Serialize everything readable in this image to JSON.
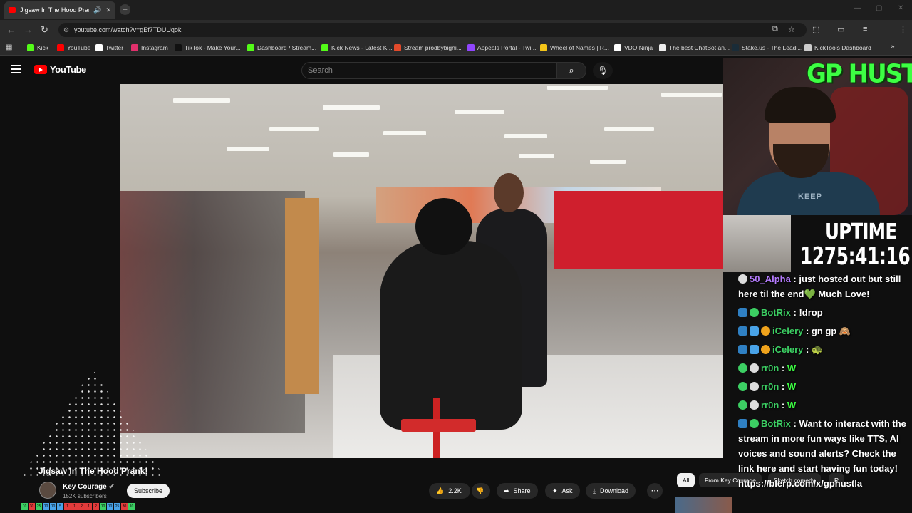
{
  "browser": {
    "tab_title": "Jigsaw In The Hood Prank!",
    "url": "youtube.com/watch?v=gEf7TDUUqok",
    "bookmarks": [
      {
        "label": "Kick",
        "color": "#53fc18"
      },
      {
        "label": "YouTube",
        "color": "#ff0000"
      },
      {
        "label": "Twitter",
        "color": "#ffffff"
      },
      {
        "label": "Instagram",
        "color": "#e1306c"
      },
      {
        "label": "TikTok - Make Your...",
        "color": "#111111"
      },
      {
        "label": "Dashboard / Stream...",
        "color": "#53fc18"
      },
      {
        "label": "Kick News - Latest K...",
        "color": "#53fc18"
      },
      {
        "label": "Stream prodbybigni...",
        "color": "#e24a2b"
      },
      {
        "label": "Appeals Portal - Twi...",
        "color": "#9146ff"
      },
      {
        "label": "Wheel of Names | R...",
        "color": "#f5c518"
      },
      {
        "label": "VDO.Ninja",
        "color": "#ffffff"
      },
      {
        "label": "The best ChatBot an...",
        "color": "#eeeeee"
      },
      {
        "label": "Stake.us - The Leadi...",
        "color": "#1a2c38"
      },
      {
        "label": "KickTools Dashboard",
        "color": "#cccccc"
      }
    ]
  },
  "youtube": {
    "logo_text": "YouTube",
    "search_placeholder": "Search",
    "video_title": "Jigsaw In The Hood Prank!",
    "channel_name": "Key Courage",
    "channel_subs": "152K subscribers",
    "subscribe_label": "Subscribe",
    "likes": "2.2K",
    "share_label": "Share",
    "ask_label": "Ask",
    "download_label": "Download",
    "chips": [
      "All",
      "From Key Courage",
      "Sketch comedy",
      "R"
    ],
    "strip_numbers": [
      "10",
      "30",
      "25",
      "10",
      "10",
      "5",
      "1",
      "1",
      "2",
      "1",
      "2",
      "10",
      "10",
      "25",
      "30",
      "10"
    ]
  },
  "stream": {
    "banner": "GP HUSTLA",
    "uptime_label": "UPTIME",
    "uptime_value": "1275:41:16",
    "shirt_text": "KEEP",
    "chat": [
      {
        "user": "50_Alpha",
        "color": "#b57bff",
        "text": " : just hosted out but still here til the end",
        "suffix": " Much Love!",
        "heart": "💚",
        "badges": [
          "b-mask"
        ]
      },
      {
        "user": "BotRix",
        "color": "#3ccf63",
        "text": " : !drop",
        "badges": [
          "b-mod",
          "b-check"
        ]
      },
      {
        "user": "iCelery",
        "color": "#3ccf63",
        "text": " : gn gp 🙈",
        "badges": [
          "b-mod",
          "b-cube",
          "b-coin"
        ]
      },
      {
        "user": "iCelery",
        "color": "#3ccf63",
        "text": " : 🐢",
        "badges": [
          "b-mod",
          "b-cube",
          "b-coin"
        ]
      },
      {
        "user": "rr0n",
        "color": "#3ccf63",
        "text": " : ",
        "suffix": "W",
        "badges": [
          "b-check",
          "b-mask"
        ]
      },
      {
        "user": "rr0n",
        "color": "#3ccf63",
        "text": " : ",
        "suffix": "W",
        "badges": [
          "b-check",
          "b-mask"
        ]
      },
      {
        "user": "rr0n",
        "color": "#3ccf63",
        "text": " : ",
        "suffix": "W",
        "badges": [
          "b-check",
          "b-mask"
        ]
      },
      {
        "user": "BotRix",
        "color": "#3ccf63",
        "text": " : Want to interact with the stream in more fun ways like TTS, AI voices and sound alerts? Check the link here and start having fun today! https://blerp.com/x/gphustla",
        "badges": [
          "b-mod",
          "b-check"
        ]
      }
    ]
  }
}
